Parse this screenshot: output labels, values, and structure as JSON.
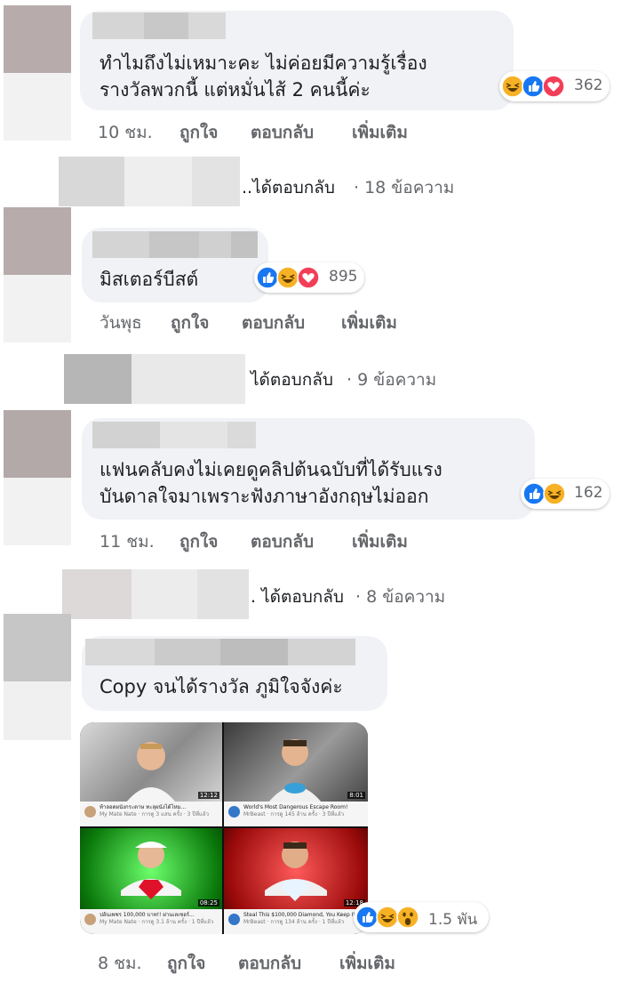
{
  "comments": [
    {
      "text_lines": [
        "ทำไมถึงไม่เหมาะคะ ไม่ค่อยมีความรู้เรื่อง",
        "รางวัลพวกนี้ แต่หมั่นไส้ 2 คนนี้ค่ะ"
      ],
      "reaction_icons": [
        "haha",
        "like",
        "love"
      ],
      "reaction_count": "362",
      "time": "10 ชม.",
      "like_label": "ถูกใจ",
      "reply_label": "ตอบกลับ",
      "more_label": "เพิ่มเติม",
      "replies_text": "..ได้ตอบกลับ",
      "replies_count": "· 18 ข้อความ"
    },
    {
      "text_lines": [
        "มิสเตอร์บีสต์"
      ],
      "reaction_icons": [
        "like",
        "haha",
        "love"
      ],
      "reaction_count": "895",
      "time": "วันพุธ",
      "like_label": "ถูกใจ",
      "reply_label": "ตอบกลับ",
      "more_label": "เพิ่มเติม",
      "replies_text": "ได้ตอบกลับ",
      "replies_count": "· 9 ข้อความ"
    },
    {
      "text_lines": [
        "แฟนคลับคงไม่เคยดูคลิปต้นฉบับที่ได้รับแรง",
        "บันดาลใจมาเพราะฟังภาษาอังกฤษไม่ออก"
      ],
      "reaction_icons": [
        "like",
        "haha"
      ],
      "reaction_count": "162",
      "time": "11 ชม.",
      "like_label": "ถูกใจ",
      "reply_label": "ตอบกลับ",
      "more_label": "เพิ่มเติม",
      "replies_text": ". ได้ตอบกลับ",
      "replies_count": "· 8 ข้อความ"
    },
    {
      "text_lines": [
        "Copy จนได้รางวัล ภูมิใจจังค่ะ"
      ],
      "reaction_icons": [
        "like",
        "haha",
        "wow"
      ],
      "reaction_count": "1.5 พัน",
      "time": "8 ชม.",
      "like_label": "ถูกใจ",
      "reply_label": "ตอบกลับ",
      "more_label": "เพิ่มเติม"
    }
  ],
  "image_attachment": {
    "videos": [
      {
        "title": "ท้าลอดผนังกระดาษ ทะลุผนังได้ไหม...",
        "channel": "My Mate Nate · การดู 3 แสน ครั้ง · 3 ปีที่แล้ว",
        "duration": "12:12"
      },
      {
        "title": "World's Most Dangerous Escape Room!",
        "channel": "MrBeast · การดู 145 ล้าน ครั้ง · 3 ปีที่แล้ว",
        "duration": "8:01"
      },
      {
        "title": "ปล้นเพชร 100,000 บาท!! ผ่านเลเซอร์...",
        "channel": "My Mate Nate · การดู 3.1 ล้าน ครั้ง · 1 ปีที่แล้ว",
        "duration": "08:25"
      },
      {
        "title": "Steal This $100,000 Diamond, You Keep It",
        "channel": "MrBeast · การดู 134 ล้าน ครั้ง · 1 ปีที่แล้ว",
        "duration": "12:18"
      }
    ]
  },
  "colors": {
    "bubble": "#f0f2f5",
    "meta_text": "#65676b",
    "like_blue": "#1877f2",
    "love_red": "#f33e58",
    "haha_yellow": "#f7b125"
  }
}
